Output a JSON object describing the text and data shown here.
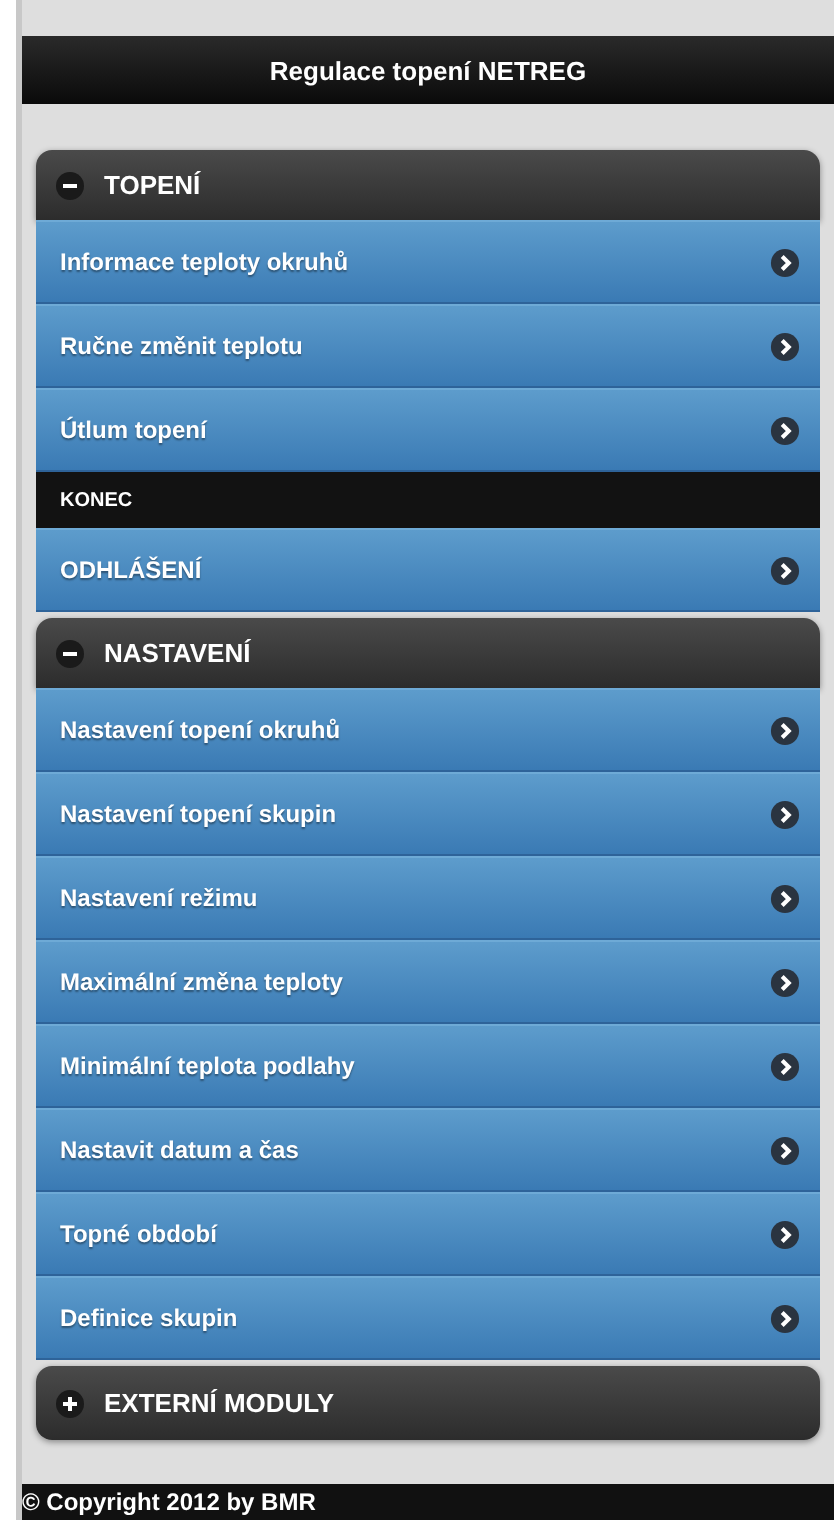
{
  "header": {
    "title": "Regulace topení NETREG"
  },
  "sections": [
    {
      "title": "TOPENÍ",
      "expanded": true,
      "entries": [
        {
          "kind": "link",
          "label": "Informace teploty okruhů"
        },
        {
          "kind": "link",
          "label": "Ručne změnit teplotu"
        },
        {
          "kind": "link",
          "label": "Útlum topení"
        },
        {
          "kind": "divider",
          "label": "KONEC"
        },
        {
          "kind": "link",
          "label": "ODHLÁŠENÍ"
        }
      ]
    },
    {
      "title": "NASTAVENÍ",
      "expanded": true,
      "entries": [
        {
          "kind": "link",
          "label": "Nastavení topení okruhů"
        },
        {
          "kind": "link",
          "label": "Nastavení topení skupin"
        },
        {
          "kind": "link",
          "label": "Nastavení režimu"
        },
        {
          "kind": "link",
          "label": "Maximální změna teploty"
        },
        {
          "kind": "link",
          "label": "Minimální teplota podlahy"
        },
        {
          "kind": "link",
          "label": "Nastavit datum a čas"
        },
        {
          "kind": "link",
          "label": "Topné období"
        },
        {
          "kind": "link",
          "label": "Definice skupin"
        }
      ]
    },
    {
      "title": "EXTERNÍ MODULY",
      "expanded": false
    }
  ],
  "footer": {
    "text": "© Copyright 2012 by BMR"
  }
}
